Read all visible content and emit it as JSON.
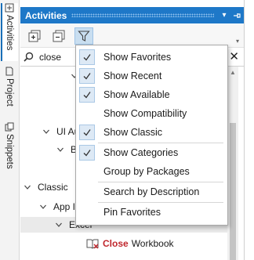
{
  "sidebar": {
    "tabs": [
      {
        "label": "Activities",
        "active": true
      },
      {
        "label": "Project",
        "active": false
      },
      {
        "label": "Snippets",
        "active": false
      }
    ]
  },
  "panel": {
    "title": "Activities",
    "title_buttons": {
      "dropdown": "▾",
      "pin": "⊓"
    }
  },
  "toolbar": {
    "buttons": [
      "expand-all",
      "collapse-all",
      "filter"
    ],
    "overflow": "▾"
  },
  "search": {
    "value": "close",
    "clear_glyph": "✕"
  },
  "tree": {
    "nodes": [
      {
        "label": "",
        "level": 3,
        "expanded": true
      },
      {
        "label": "UI Au",
        "level": 1,
        "expanded": true
      },
      {
        "label": "B",
        "level": 2,
        "expanded": true
      },
      {
        "label": "Classic",
        "level": 0,
        "expanded": true
      },
      {
        "label": "App I",
        "level": 1,
        "expanded": true
      },
      {
        "label": "Excel",
        "level": 2,
        "expanded": true,
        "selected": true
      },
      {
        "highlight": "Close",
        "rest": "Workbook",
        "level": 3,
        "leaf": true
      }
    ]
  },
  "filter_menu": {
    "items": [
      {
        "label": "Show Favorites",
        "checked": true
      },
      {
        "label": "Show Recent",
        "checked": true
      },
      {
        "label": "Show Available",
        "checked": true
      },
      {
        "label": "Show Compatibility",
        "checked": false
      },
      {
        "label": "Show Classic",
        "checked": true
      },
      {
        "label": "Show Categories",
        "checked": true
      },
      {
        "label": "Group by Packages",
        "checked": false
      },
      {
        "label": "Search by Description",
        "checked": false
      },
      {
        "label": "Pin Favorites",
        "checked": false
      }
    ]
  },
  "colors": {
    "title_bar": "#1e78c8",
    "highlight_text": "#c0272d",
    "check_bg": "#dde9f5"
  }
}
